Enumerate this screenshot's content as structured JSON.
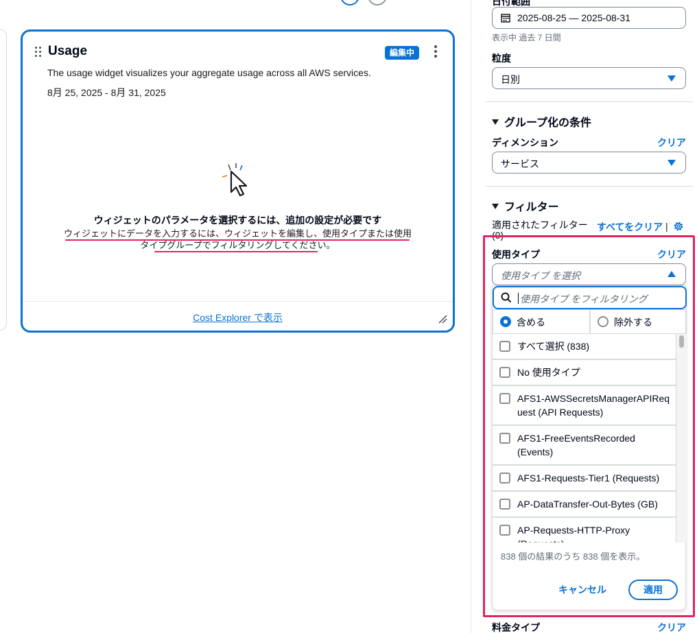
{
  "widget": {
    "title": "Usage",
    "badge": "編集中",
    "description": "The usage widget visualizes your aggregate usage across all AWS services.",
    "date_range": "8月 25, 2025 - 8月 31, 2025",
    "empty_title": "ウィジェットのパラメータを選択するには、追加の設定が必要です",
    "empty_body": "ウィジェットにデータを入力するには、ウィジェットを編集し、使用タイプまたは使用タイプグループでフィルタリングしてください。",
    "footer_link": "Cost Explorer で表示"
  },
  "panel": {
    "top_label": "日付範囲",
    "date_value": "2025-08-25 — 2025-08-31",
    "date_hint": "表示中 過去 7 日間",
    "granularity_label": "粒度",
    "granularity_value": "日別",
    "groupby_title": "グループ化の条件",
    "dimension_label": "ディメンション",
    "dimension_clear": "クリア",
    "dimension_value": "サービス",
    "filters_title": "フィルター",
    "applied_filters": "適用されたフィルター (0)",
    "clear_all": "すべてをクリア",
    "usage_type_label": "使用タイプ",
    "usage_type_clear": "クリア",
    "usage_type_placeholder": "使用タイプ を選択",
    "filter_placeholder": "使用タイプ をフィルタリング",
    "include_label": "含める",
    "exclude_label": "除外する",
    "options": [
      "すべて選択 (838)",
      "No 使用タイプ",
      "AFS1-AWSSecretsManagerAPIRequest (API Requests)",
      "AFS1-FreeEventsRecorded (Events)",
      "AFS1-Requests-Tier1 (Requests)",
      "AP-DataTransfer-Out-Bytes (GB)",
      "AP-Requests-HTTP-Proxy (Requests)"
    ],
    "results_text": "838 個の結果のうち 838 個を表示。",
    "cancel_label": "キャンセル",
    "apply_label": "適用",
    "charge_type_label": "料金タイプ",
    "charge_type_clear": "クリア"
  },
  "colors": {
    "accent": "#0972d3",
    "highlight": "#e0245e"
  }
}
